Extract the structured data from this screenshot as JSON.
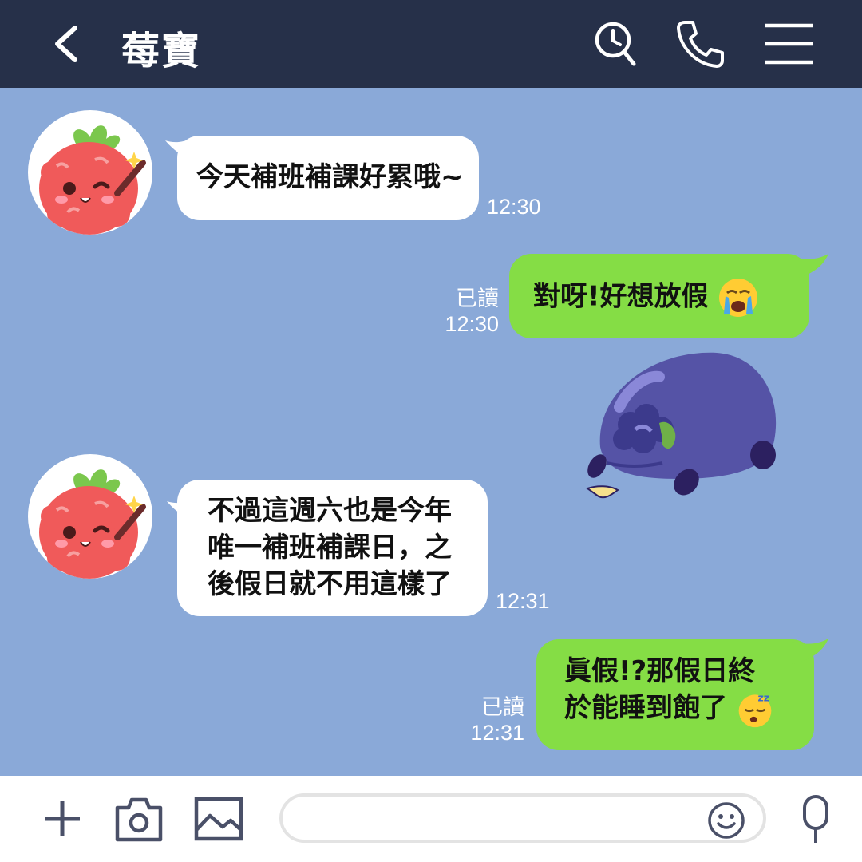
{
  "header": {
    "title": "莓寶",
    "icons": [
      "back-icon",
      "timeline-search-icon",
      "phone-icon",
      "menu-icon"
    ]
  },
  "messages": [
    {
      "side": "in",
      "text": "今天補班補課好累哦~",
      "time": "12:30"
    },
    {
      "side": "out",
      "text": "對呀!好想放假",
      "emoji": "crying-face-emoji",
      "read": "已讀",
      "time": "12:30"
    },
    {
      "side": "out",
      "sticker": "blueberry-lying-sticker"
    },
    {
      "side": "in",
      "lines": [
        "不過這週六也是今年",
        "唯一補班補課日，之",
        "後假日就不用這樣了"
      ],
      "time": "12:31"
    },
    {
      "side": "out",
      "lines": [
        "眞假!?那假日終",
        "於能睡到飽了"
      ],
      "emoji": "sleeping-face-emoji",
      "read": "已讀",
      "time": "12:31"
    }
  ],
  "composer": {
    "placeholder": "",
    "icons": [
      "plus-icon",
      "camera-icon",
      "image-icon",
      "emoji-icon",
      "microphone-icon"
    ]
  },
  "colors": {
    "header_bg": "#263049",
    "chat_bg": "#8aa9d8",
    "incoming_bubble": "#ffffff",
    "outgoing_bubble": "#85dd45",
    "raspberry": "#f05a5a",
    "blueberry": "#5553a6"
  }
}
